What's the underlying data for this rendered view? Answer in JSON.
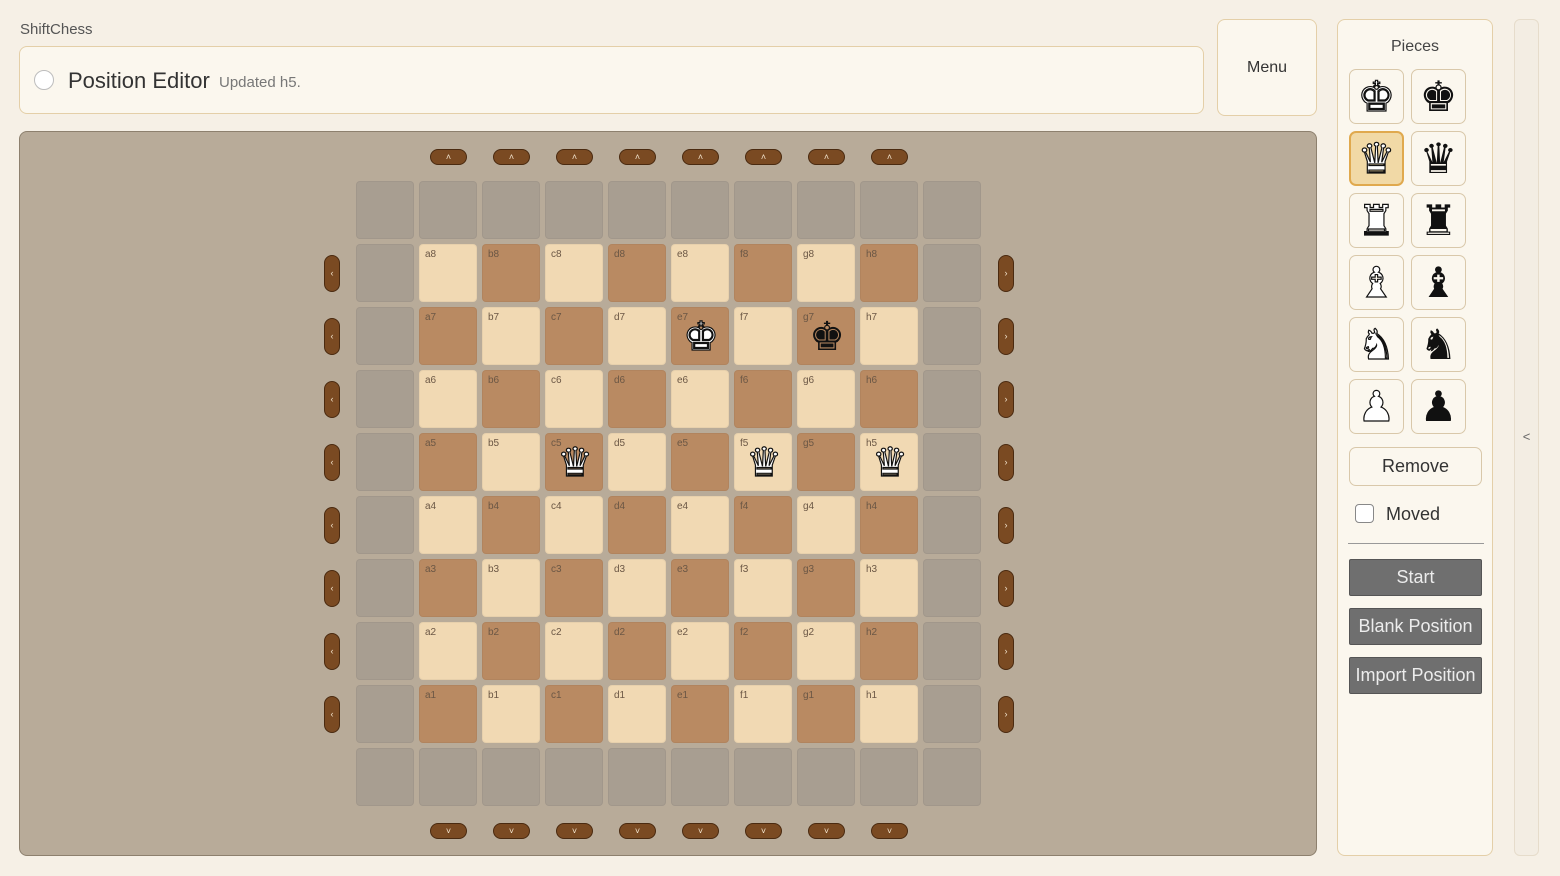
{
  "app": {
    "name": "ShiftChess"
  },
  "header": {
    "title": "Position Editor",
    "status": "Updated h5."
  },
  "menu": {
    "label": "Menu"
  },
  "board": {
    "files": [
      "a",
      "b",
      "c",
      "d",
      "e",
      "f",
      "g",
      "h"
    ],
    "ranks": [
      "8",
      "7",
      "6",
      "5",
      "4",
      "3",
      "2",
      "1"
    ],
    "pieces": [
      {
        "square": "e7",
        "color": "white",
        "type": "king",
        "glyph": "♚"
      },
      {
        "square": "g7",
        "color": "black",
        "type": "king",
        "glyph": "♚"
      },
      {
        "square": "c5",
        "color": "white",
        "type": "queen",
        "glyph": "♛"
      },
      {
        "square": "f5",
        "color": "white",
        "type": "queen",
        "glyph": "♛"
      },
      {
        "square": "h5",
        "color": "white",
        "type": "queen",
        "glyph": "♛"
      }
    ],
    "shift_glyphs": {
      "up": "˄",
      "down": "˅",
      "left": "‹",
      "right": "›"
    }
  },
  "sidebar": {
    "title": "Pieces",
    "palette": [
      {
        "name": "white-king-icon",
        "color": "white",
        "glyph": "♚",
        "selected": false
      },
      {
        "name": "black-king-icon",
        "color": "black",
        "glyph": "♚",
        "selected": false
      },
      {
        "name": "white-queen-icon",
        "color": "white",
        "glyph": "♛",
        "selected": true
      },
      {
        "name": "black-queen-icon",
        "color": "black",
        "glyph": "♛",
        "selected": false
      },
      {
        "name": "white-rook-icon",
        "color": "white",
        "glyph": "♜",
        "selected": false
      },
      {
        "name": "black-rook-icon",
        "color": "black",
        "glyph": "♜",
        "selected": false
      },
      {
        "name": "white-bishop-icon",
        "color": "white",
        "glyph": "♝",
        "selected": false
      },
      {
        "name": "black-bishop-icon",
        "color": "black",
        "glyph": "♝",
        "selected": false
      },
      {
        "name": "white-knight-icon",
        "color": "white",
        "glyph": "♞",
        "selected": false
      },
      {
        "name": "black-knight-icon",
        "color": "black",
        "glyph": "♞",
        "selected": false
      },
      {
        "name": "white-pawn-icon",
        "color": "white",
        "glyph": "♟",
        "selected": false
      },
      {
        "name": "black-pawn-icon",
        "color": "black",
        "glyph": "♟",
        "selected": false
      }
    ],
    "remove_label": "Remove",
    "moved_label": "Moved",
    "moved_checked": false,
    "start_label": "Start",
    "blank_label": "Blank Position",
    "import_label": "Import Position"
  },
  "collapse": {
    "glyph": "<"
  },
  "colors": {
    "light_square": "#f1d9b3",
    "dark_square": "#b98a62",
    "outer_square": "#a89e91",
    "shift_button": "#7a4a22",
    "selected_piece": "#e0a94e"
  }
}
